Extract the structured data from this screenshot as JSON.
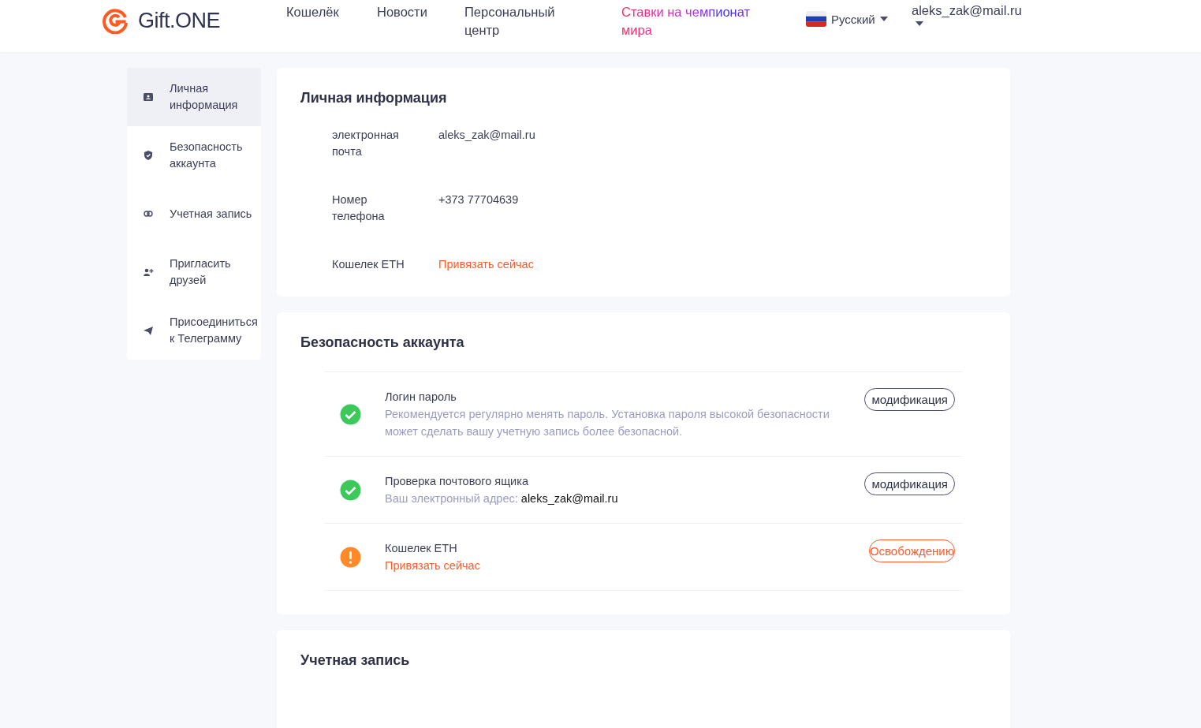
{
  "header": {
    "logo": "Gift.ONE",
    "nav": [
      {
        "label": "Кошелёк",
        "kind": "plain"
      },
      {
        "label": "Новости",
        "kind": "plain"
      },
      {
        "label": "Персональный центр",
        "kind": "plain"
      },
      {
        "label": "Ставки на чемпионат мира",
        "kind": "promo"
      }
    ],
    "language": "Русский",
    "user": "aleks_zak@mail.ru"
  },
  "sidebar": {
    "items": [
      {
        "label": "Личная информация",
        "kind": "id",
        "selected": true
      },
      {
        "label": "Безопасность аккаунта",
        "kind": "shield",
        "selected": false
      },
      {
        "label": "Учетная запись",
        "kind": "link",
        "selected": false
      },
      {
        "label": "Пригласить друзей",
        "kind": "invite",
        "selected": false
      },
      {
        "label": "Присоединиться к Телеграмму",
        "kind": "plane",
        "selected": false
      }
    ]
  },
  "personal_info": {
    "title": "Личная информация",
    "rows": [
      {
        "label": "электронная почта",
        "value": "aleks_zak@mail.ru",
        "kind": "text"
      },
      {
        "label": "Номер телефона",
        "value": "+373 77704639",
        "kind": "text"
      },
      {
        "label": "Кошелек ETH",
        "value": "Привязать сейчас",
        "kind": "link"
      }
    ]
  },
  "security": {
    "title": "Безопасность аккаунта",
    "rows": [
      {
        "kind": "ok",
        "title": "Логин пароль",
        "detail": "Рекомендуется регулярно менять пароль. Установка пароля высокой безопасности может сделать вашу учетную запись более безопасной.",
        "button": "модификация"
      },
      {
        "kind": "ok",
        "title": "Проверка почтового ящика",
        "detail": "Ваш электронный адрес:",
        "detail_value": "aleks_zak@mail.ru",
        "button": "модификация"
      },
      {
        "kind": "warn",
        "title": "Кошелек ETH",
        "detail": "Привязать сейчас",
        "button": "Освобождению"
      }
    ]
  },
  "account": {
    "title": "Учетная запись"
  }
}
